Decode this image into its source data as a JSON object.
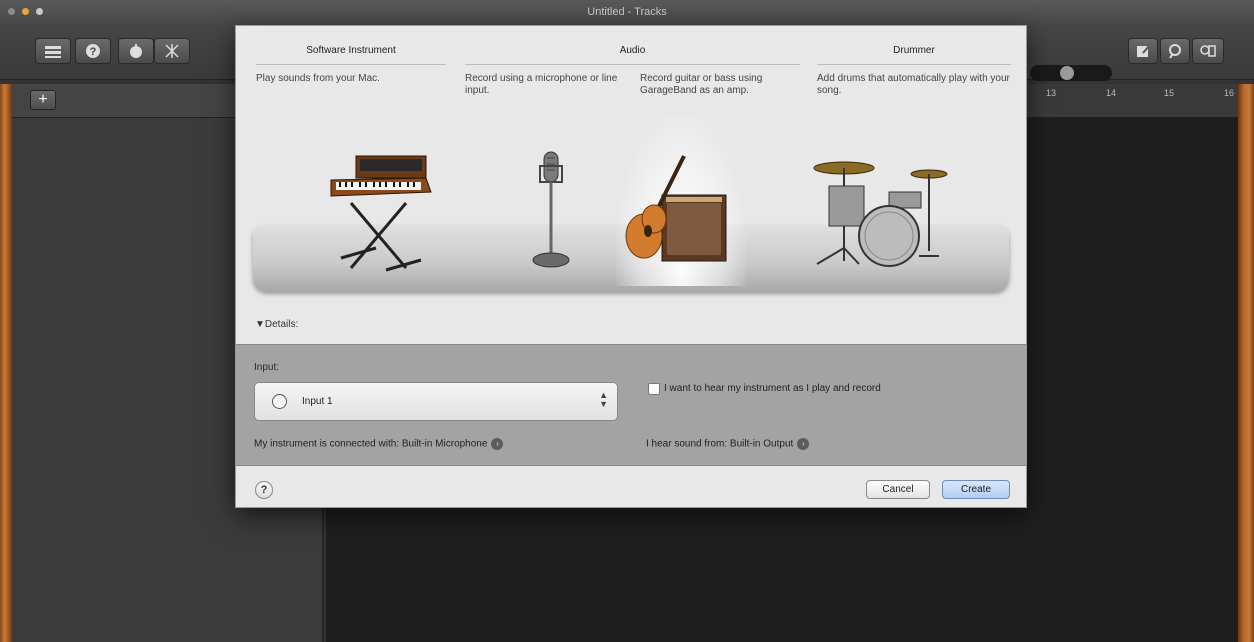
{
  "window": {
    "title": "Untitled - Tracks"
  },
  "toolbar": {
    "left_buttons": [
      "library-icon",
      "help-icon",
      "smart-controls-icon",
      "editors-icon"
    ],
    "right_buttons": [
      "note-pad-icon",
      "loop-browser-icon",
      "media-browser-icon"
    ]
  },
  "sidebar": {
    "add_label": "+"
  },
  "ruler": {
    "markers": [
      "13",
      "14",
      "15",
      "16"
    ]
  },
  "dialog": {
    "columns": [
      {
        "title": "Software Instrument",
        "description": "Play sounds from your Mac."
      },
      {
        "title": "Audio",
        "descriptions": [
          "Record using a microphone or line input.",
          "Record guitar or bass using GarageBand as an amp."
        ]
      },
      {
        "title": "Drummer",
        "description": "Add drums that automatically play with your song."
      }
    ],
    "selected_option": "guitar-amp",
    "details_label": "▼Details:",
    "input_label": "Input:",
    "input_value": "Input 1",
    "monitor_label": "I want to hear my instrument as I play and record",
    "monitor_checked": false,
    "connected_text": "My instrument is connected with: Built-in Microphone",
    "output_text": "I hear sound from: Built-in Output",
    "help_label": "?",
    "cancel_label": "Cancel",
    "create_label": "Create"
  }
}
